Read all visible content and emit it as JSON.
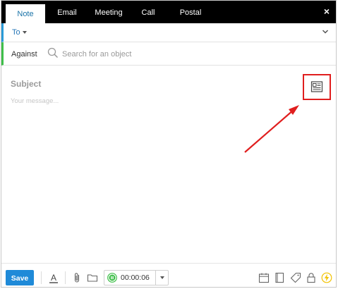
{
  "tabs": [
    {
      "label": "Note",
      "active": true
    },
    {
      "label": "Email"
    },
    {
      "label": "Meeting"
    },
    {
      "label": "Call"
    },
    {
      "label": "Postal"
    }
  ],
  "close_icon": "×",
  "to": {
    "label": "To"
  },
  "against": {
    "label": "Against",
    "search_placeholder": "Search for an object"
  },
  "compose": {
    "subject_placeholder": "Subject",
    "message_placeholder": "Your message..."
  },
  "toolbar": {
    "save_label": "Save",
    "timer_value": "00:00:06"
  },
  "icons": {
    "template": "template-icon",
    "text_format": "text-format-icon",
    "attach": "paperclip-icon",
    "folder": "folder-icon",
    "timer": "timer-pause-icon",
    "calendar": "calendar-icon",
    "book": "book-icon",
    "tag": "tag-icon",
    "lock": "lock-icon",
    "lightning": "lightning-icon"
  },
  "colors": {
    "tab_bar": "#000000",
    "active_tab_text": "#1a73a8",
    "to_accent": "#2a9ad8",
    "against_accent": "#3fbf4a",
    "save_button": "#1f8ad8",
    "highlight": "#e01e1e",
    "timer_green": "#3fbf4a",
    "lightning_yellow": "#f2c200"
  }
}
